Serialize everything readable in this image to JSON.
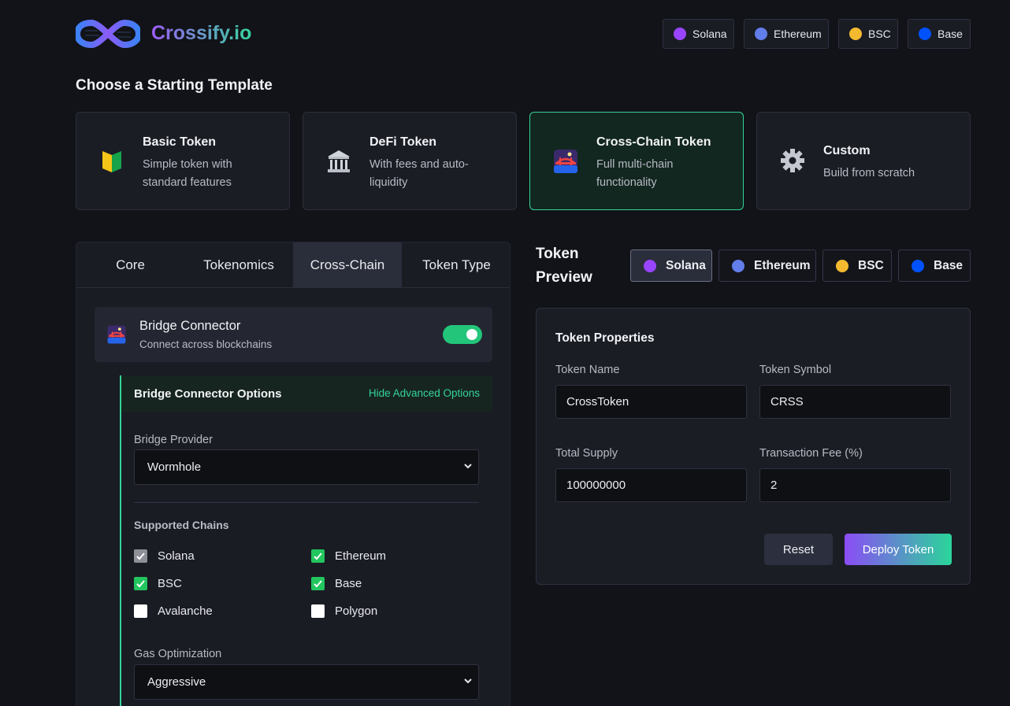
{
  "header": {
    "brand": "Crossify.io",
    "networks": [
      {
        "label": "Solana",
        "color": "#9945ff"
      },
      {
        "label": "Ethereum",
        "color": "#627eea"
      },
      {
        "label": "BSC",
        "color": "#f3ba2f"
      },
      {
        "label": "Base",
        "color": "#0052ff"
      }
    ]
  },
  "templates": {
    "heading": "Choose a Starting Template",
    "cards": [
      {
        "title": "Basic Token",
        "desc": "Simple token with standard features",
        "icon": "beginner-leaf-icon"
      },
      {
        "title": "DeFi Token",
        "desc": "With fees and auto-liquidity",
        "icon": "bank-icon"
      },
      {
        "title": "Cross-Chain Token",
        "desc": "Full multi-chain functionality",
        "icon": "bridge-icon",
        "selected": true
      },
      {
        "title": "Custom",
        "desc": "Build from scratch",
        "icon": "gear-icon"
      }
    ]
  },
  "config": {
    "tabs": [
      "Core",
      "Tokenomics",
      "Cross-Chain",
      "Token Type"
    ],
    "active_tab": "Cross-Chain",
    "bridge": {
      "title": "Bridge Connector",
      "subtitle": "Connect across blockchains",
      "enabled": true
    },
    "options": {
      "title": "Bridge Connector Options",
      "toggle_link": "Hide Advanced Options",
      "provider_label": "Bridge Provider",
      "provider_value": "Wormhole",
      "chains_title": "Supported Chains",
      "chains": [
        {
          "label": "Solana",
          "state": "disabled-checked"
        },
        {
          "label": "Ethereum",
          "state": "checked"
        },
        {
          "label": "BSC",
          "state": "checked"
        },
        {
          "label": "Base",
          "state": "checked"
        },
        {
          "label": "Avalanche",
          "state": "unchecked"
        },
        {
          "label": "Polygon",
          "state": "unchecked"
        }
      ],
      "gas_label": "Gas Optimization",
      "gas_value": "Aggressive"
    }
  },
  "preview": {
    "title": "Token Preview",
    "networks": [
      {
        "label": "Solana",
        "color": "#9945ff",
        "selected": true
      },
      {
        "label": "Ethereum",
        "color": "#627eea"
      },
      {
        "label": "BSC",
        "color": "#f3ba2f"
      },
      {
        "label": "Base",
        "color": "#0052ff"
      }
    ],
    "properties": {
      "title": "Token Properties",
      "name_label": "Token Name",
      "name_value": "CrossToken",
      "symbol_label": "Token Symbol",
      "symbol_value": "CRSS",
      "supply_label": "Total Supply",
      "supply_value": "100000000",
      "fee_label": "Transaction Fee (%)",
      "fee_value": "2",
      "reset_label": "Reset",
      "deploy_label": "Deploy Token"
    }
  }
}
